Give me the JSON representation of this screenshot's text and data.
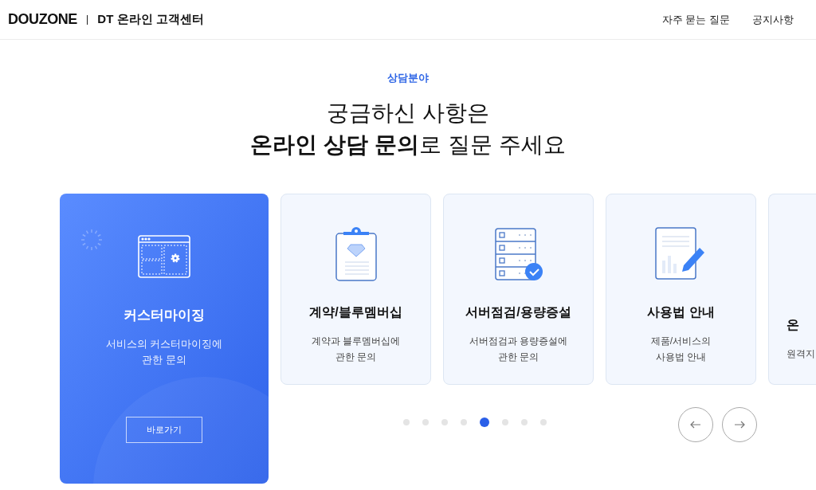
{
  "header": {
    "logo": "DOUZONE",
    "site_title": "DT 온라인 고객센터",
    "nav": [
      {
        "label": "자주 묻는 질문"
      },
      {
        "label": "공지사항"
      }
    ]
  },
  "section": {
    "eyebrow": "상담분야",
    "heading_line1": "궁금하신 사항은",
    "heading_line2": "**온라인 상담 문의**로 질문 주세요"
  },
  "cards": [
    {
      "kind": "customizing",
      "selected": true,
      "title": "커스터마이징",
      "description": [
        "서비스의 커스터마이징에",
        "관한 문의"
      ],
      "button": "바로가기"
    },
    {
      "kind": "contract",
      "selected": false,
      "title": "계약/블루멤버십",
      "description": [
        "계약과 블루멤버십에",
        "관한 문의"
      ]
    },
    {
      "kind": "server",
      "selected": false,
      "title": "서버점검/용량증설",
      "description": [
        "서버점검과 용량증설에",
        "관한 문의"
      ]
    },
    {
      "kind": "manual",
      "selected": false,
      "title": "사용법 안내",
      "description": [
        "제품/서비스의",
        "사용법 안내"
      ]
    },
    {
      "kind": "partial",
      "selected": false,
      "title": "온",
      "description": [
        "원격지"
      ]
    }
  ],
  "pager": [
    {
      "selected": false
    },
    {
      "selected": false
    },
    {
      "selected": false
    },
    {
      "selected": false
    },
    {
      "selected": true
    },
    {
      "selected": false
    },
    {
      "selected": false
    },
    {
      "selected": false
    }
  ]
}
